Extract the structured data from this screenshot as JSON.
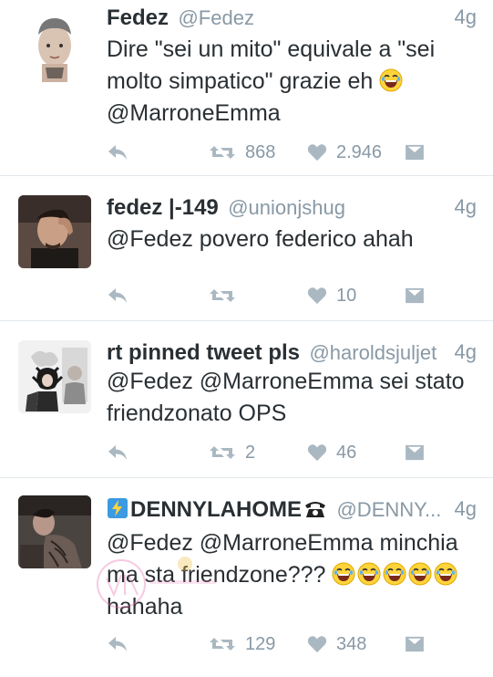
{
  "tweets": [
    {
      "name": "Fedez",
      "handle": "@Fedez",
      "time": "4g",
      "lines": [
        "Dire \"sei un mito\" equivale a \"sei",
        "molto simpatico\" grazie eh",
        "@MarroneEmma"
      ],
      "retweets": "868",
      "likes": "2.946"
    },
    {
      "name": "fedez |-149",
      "handle": "@unionjshug",
      "time": "4g",
      "lines": [
        "@Fedez povero federico ahah"
      ],
      "retweets": "",
      "likes": "10"
    },
    {
      "name": "rt pinned tweet pls",
      "handle": "@haroldsjuljet",
      "time": "4g",
      "lines": [
        "@Fedez @MarroneEmma sei stato",
        "friendzonato OPS"
      ],
      "retweets": "2",
      "likes": "46"
    },
    {
      "name": "DENNYLAHOME",
      "handle": "@DENNY...",
      "time": "4g",
      "lines": [
        "@Fedez @MarroneEmma minchia",
        "ma sta friendzone???",
        "hahaha"
      ],
      "retweets": "129",
      "likes": "348"
    }
  ],
  "colors": {
    "text": "#292f33",
    "muted": "#8899a6",
    "icon": "#aab8c2",
    "divider": "#e1e8ed"
  },
  "icons": [
    "reply-icon",
    "retweet-icon",
    "heart-icon",
    "direct-message-icon",
    "laughing-emoji",
    "telephone-emoji",
    "lightning-box-emoji"
  ]
}
